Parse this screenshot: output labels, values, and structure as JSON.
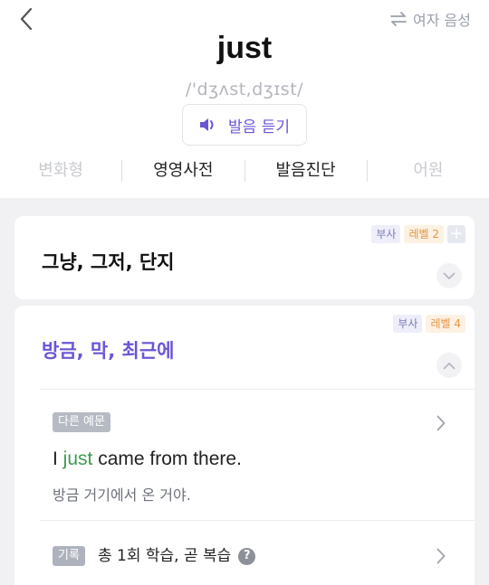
{
  "header": {
    "word": "just",
    "phonetic": "/'dʒʌst,dʒɪst/",
    "voice_label": "여자 음성",
    "listen_label": "발음 듣기"
  },
  "tabs": [
    {
      "label": "변화형",
      "enabled": false
    },
    {
      "label": "영영사전",
      "enabled": true
    },
    {
      "label": "발음진단",
      "enabled": true
    },
    {
      "label": "어원",
      "enabled": false
    }
  ],
  "meanings": [
    {
      "text": "그냥, 그저, 단지",
      "pos": "부사",
      "level": "레벨 2",
      "add_label": "+"
    },
    {
      "text": "방금, 막, 최근에",
      "pos": "부사",
      "level": "레벨 4",
      "example_tag": "다른 예문",
      "example": {
        "before": "I ",
        "highlight": "just",
        "after": " came from there."
      },
      "translation": "방금 거기에서 온 거야.",
      "record_tag": "기록",
      "record_text": "총 1회 학습, 곧 복습",
      "help": "?"
    }
  ],
  "colors": {
    "accent": "#6a56d6",
    "highlight": "#3f9a52",
    "level": "#e39644"
  },
  "icons": [
    "back-arrow-icon",
    "swap-arrows-icon",
    "speaker-icon",
    "chevron-down-icon",
    "chevron-up-icon",
    "chevron-right-icon",
    "help-icon",
    "plus-icon"
  ]
}
